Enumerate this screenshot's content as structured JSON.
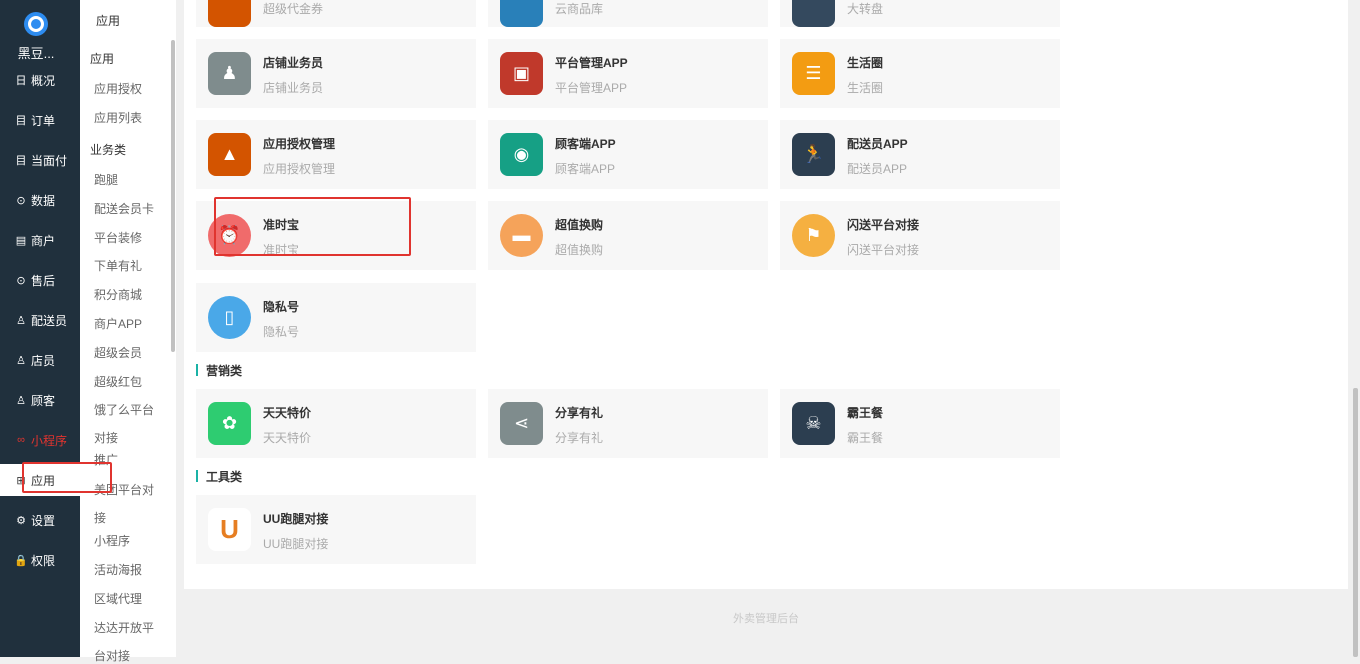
{
  "brand": {
    "name": "黑豆..."
  },
  "leftnav": [
    {
      "label": "概况",
      "icon": "日"
    },
    {
      "label": "订单",
      "icon": "目"
    },
    {
      "label": "当面付",
      "icon": "目"
    },
    {
      "label": "数据",
      "icon": "⊙"
    },
    {
      "label": "商户",
      "icon": "▤"
    },
    {
      "label": "售后",
      "icon": "⊙"
    },
    {
      "label": "配送员",
      "icon": "♙"
    },
    {
      "label": "店员",
      "icon": "♙"
    },
    {
      "label": "顾客",
      "icon": "♙"
    },
    {
      "label": "小程序",
      "icon": "∞"
    },
    {
      "label": "应用",
      "icon": "⊞"
    },
    {
      "label": "设置",
      "icon": "⚙"
    },
    {
      "label": "权限",
      "icon": "🔒"
    }
  ],
  "subnav": {
    "top": "应用",
    "heads": {
      "app": "应用",
      "biz": "业务类"
    },
    "app_items": [
      "应用授权",
      "应用列表"
    ],
    "biz_items": [
      "跑腿",
      "配送会员卡",
      "平台装修",
      "下单有礼",
      "积分商城",
      "商户APP",
      "超级会员",
      "超级红包",
      "饿了么平台",
      "对接",
      "推广",
      "美团平台对",
      "接",
      "小程序",
      "活动海报",
      "区域代理",
      "达达开放平",
      "台对接"
    ]
  },
  "cards": {
    "row0": [
      {
        "title": "",
        "sub": "超级代金券",
        "color": "#d35400"
      },
      {
        "title": "",
        "sub": "云商品库",
        "color": "#2980b9"
      },
      {
        "title": "",
        "sub": "大转盘",
        "color": "#34495e"
      }
    ],
    "business": [
      {
        "title": "店铺业务员",
        "sub": "店铺业务员",
        "color": "#7f8c8d",
        "glyph": "♟"
      },
      {
        "title": "平台管理APP",
        "sub": "平台管理APP",
        "color": "#c0392b",
        "glyph": "▣"
      },
      {
        "title": "生活圈",
        "sub": "生活圈",
        "color": "#f39c12",
        "glyph": "☰"
      },
      {
        "title": "应用授权管理",
        "sub": "应用授权管理",
        "color": "#d35400",
        "glyph": "▲"
      },
      {
        "title": "顾客端APP",
        "sub": "顾客端APP",
        "color": "#16a085",
        "glyph": "◉"
      },
      {
        "title": "配送员APP",
        "sub": "配送员APP",
        "color": "#2c3e50",
        "glyph": "🏃"
      },
      {
        "title": "准时宝",
        "sub": "准时宝",
        "color": "#f06b6b",
        "glyph": "⏰"
      },
      {
        "title": "超值换购",
        "sub": "超值换购",
        "color": "#f5a35a",
        "glyph": "▬"
      },
      {
        "title": "闪送平台对接",
        "sub": "闪送平台对接",
        "color": "#f5b041",
        "glyph": "⚑"
      },
      {
        "title": "隐私号",
        "sub": "隐私号",
        "color": "#4aa8e8",
        "glyph": "▯"
      }
    ],
    "marketing_title": "营销类",
    "marketing": [
      {
        "title": "天天特价",
        "sub": "天天特价",
        "color": "#2ecc71",
        "glyph": "✿"
      },
      {
        "title": "分享有礼",
        "sub": "分享有礼",
        "color": "#7f8c8d",
        "glyph": "⋖"
      },
      {
        "title": "霸王餐",
        "sub": "霸王餐",
        "color": "#2c3e50",
        "glyph": "☠"
      }
    ],
    "tools_title": "工具类",
    "tools": [
      {
        "title": "UU跑腿对接",
        "sub": "UU跑腿对接",
        "color": "#ffffff",
        "glyph": "U"
      }
    ]
  },
  "footer": "外卖管理后台"
}
